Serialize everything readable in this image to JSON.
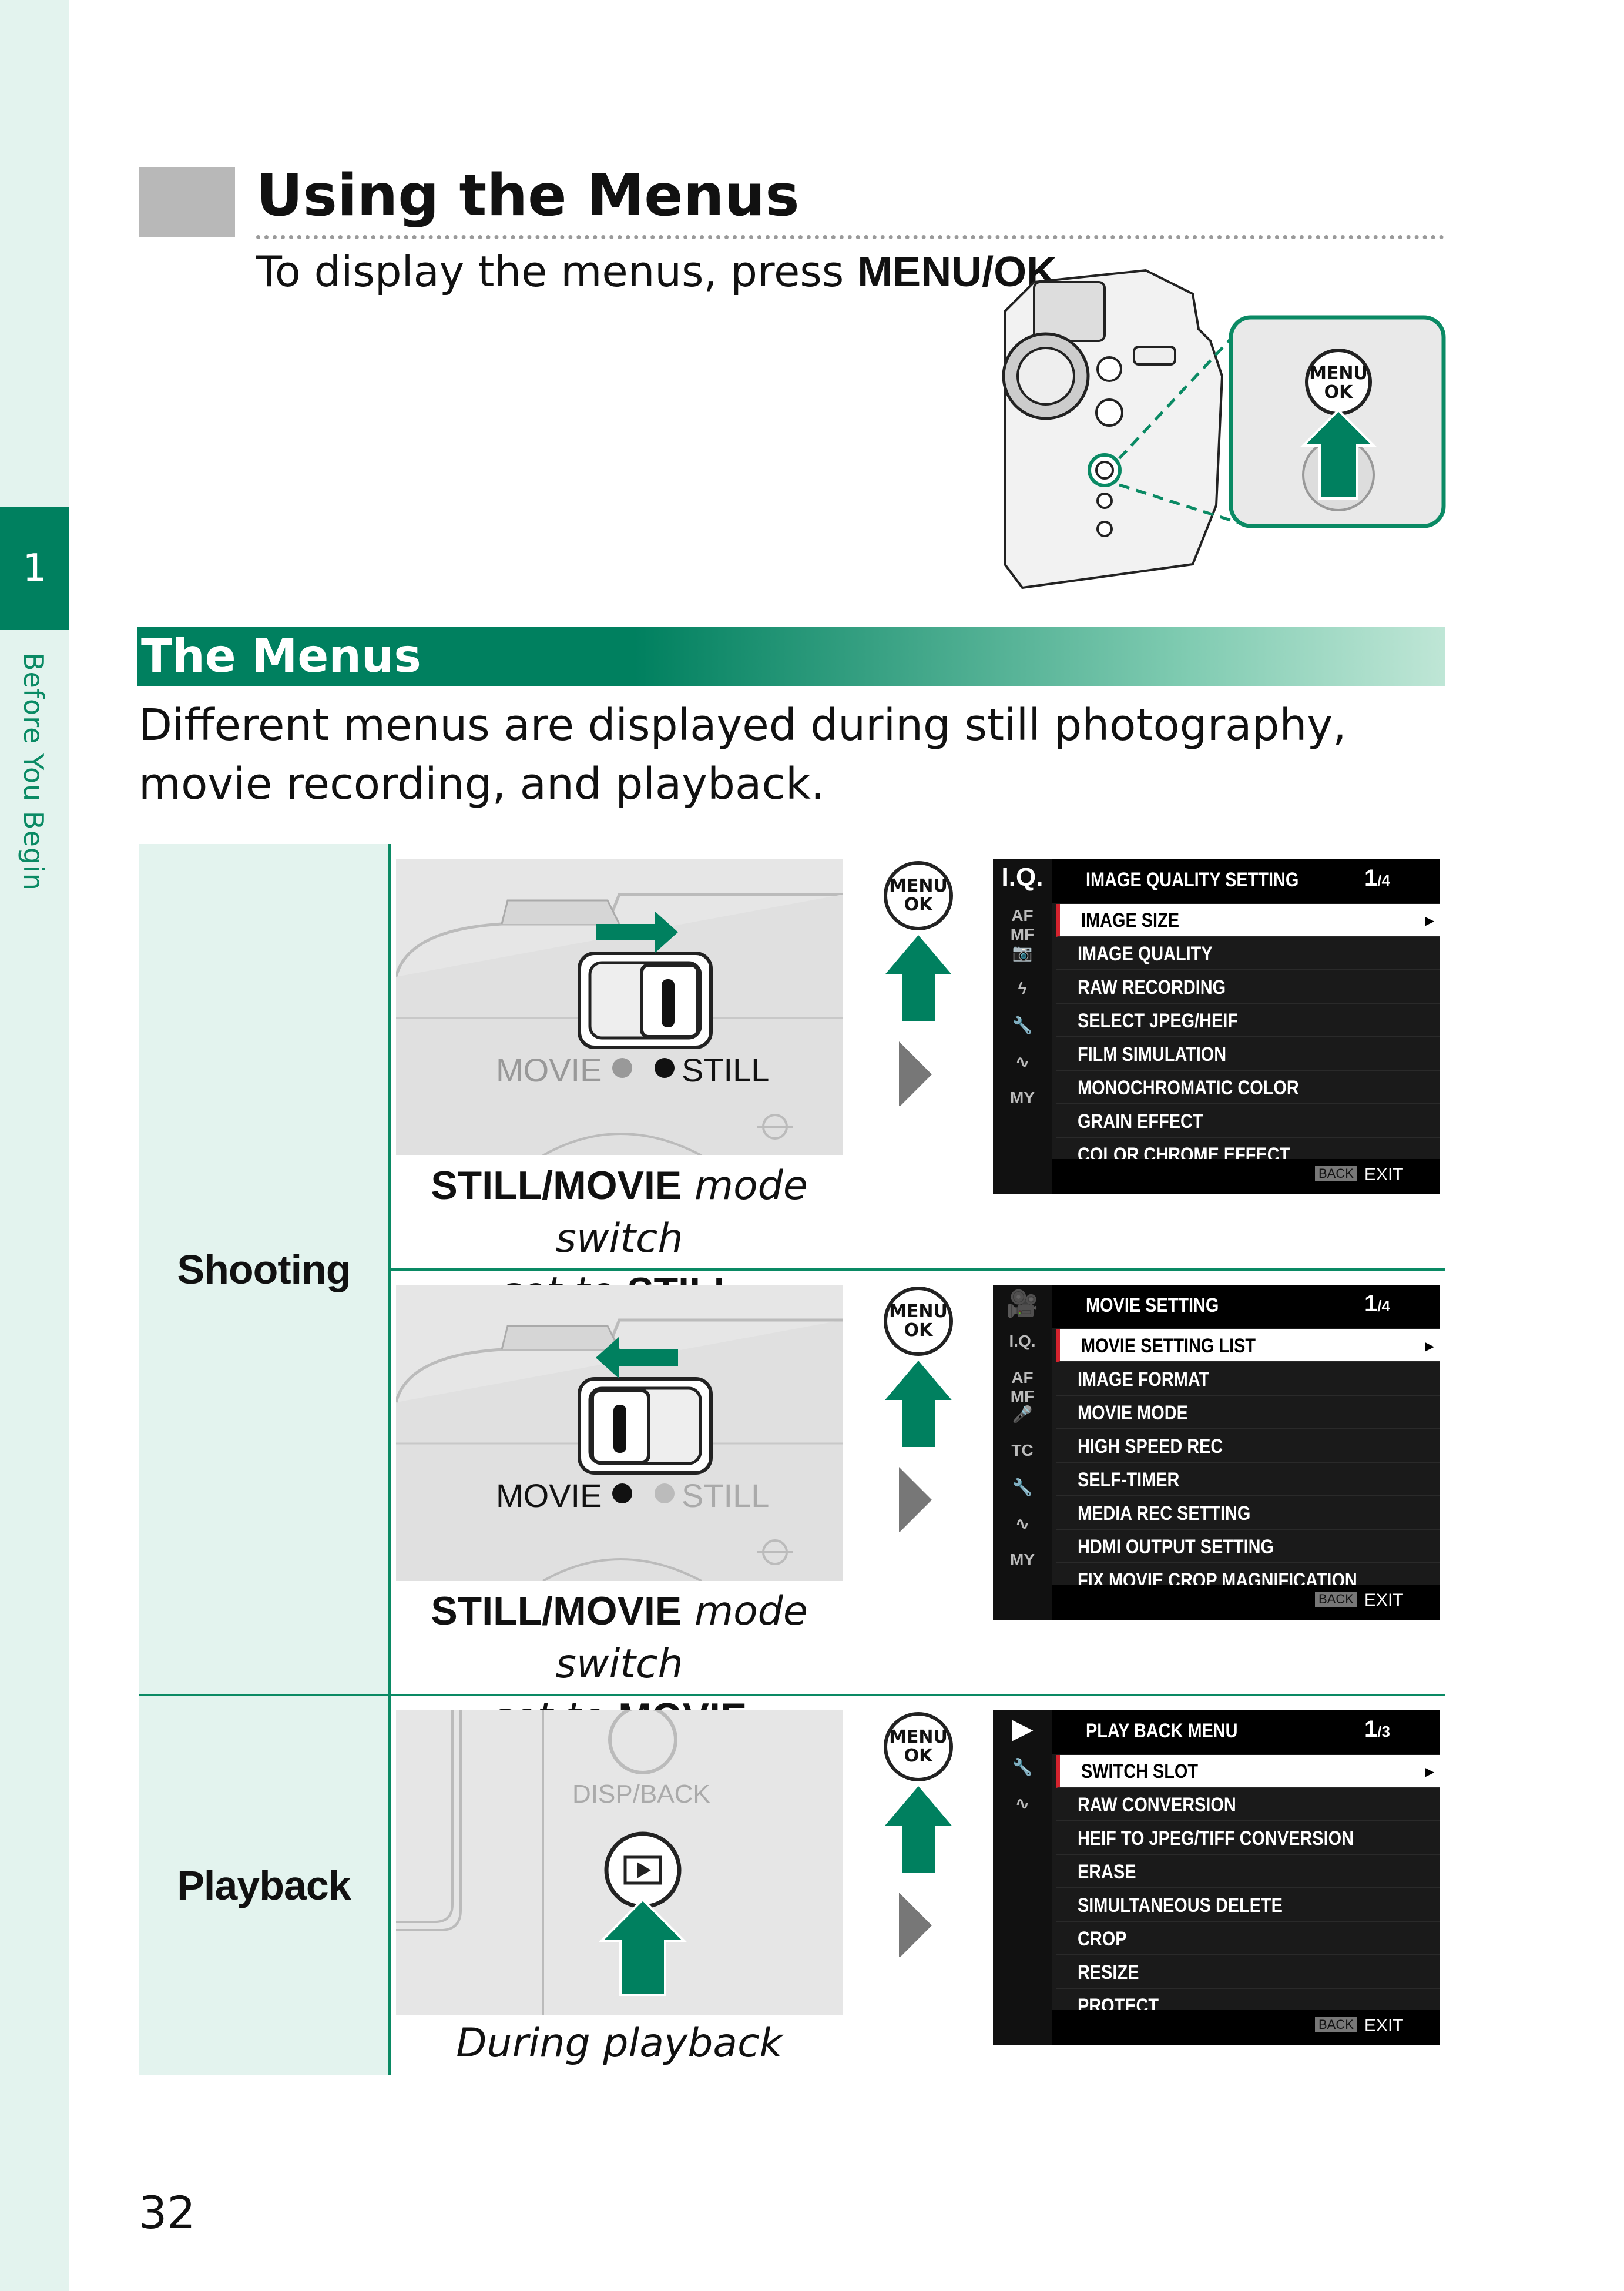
{
  "chapter": {
    "number": "1",
    "label": "Before You Begin"
  },
  "heading": {
    "title": "Using the Menus",
    "intro_text": "To display the menus, press ",
    "intro_button": "MENU/OK",
    "intro_end": "."
  },
  "section": {
    "title": "The Menus",
    "description": "Different menus are displayed during still photography, movie recording, and playback."
  },
  "button_label": {
    "menu": "MENU",
    "ok": "OK"
  },
  "rows": {
    "shooting": {
      "label": "Shooting",
      "switch_labels": {
        "movie": "MOVIE",
        "still": "STILL"
      },
      "still": {
        "caption_bold": "STILL/MOVIE",
        "caption_text": " mode switch",
        "caption_text2": "set to ",
        "caption_value": "STILL",
        "screen": {
          "title": "IMAGE QUALITY SETTING",
          "page": "1",
          "pages": "/4",
          "side_icons": [
            "I.Q.",
            "AF MF",
            "📷",
            "ϟ",
            "🔧",
            "∿",
            "MY"
          ],
          "items": [
            "IMAGE SIZE",
            "IMAGE QUALITY",
            "RAW RECORDING",
            "SELECT JPEG/HEIF",
            "FILM SIMULATION",
            "MONOCHROMATIC COLOR",
            "GRAIN EFFECT",
            "COLOR CHROME EFFECT"
          ],
          "back": "BACK",
          "exit": "EXIT"
        }
      },
      "movie": {
        "caption_bold": "STILL/MOVIE",
        "caption_text": " mode switch",
        "caption_text2": "set to ",
        "caption_value": "MOVIE",
        "screen": {
          "title": "MOVIE SETTING",
          "page": "1",
          "pages": "/4",
          "side_icons": [
            "🎥",
            "I.Q.",
            "AF MF",
            "🎤",
            "TC",
            "🔧",
            "∿",
            "MY"
          ],
          "items": [
            "MOVIE SETTING LIST",
            "IMAGE FORMAT",
            "MOVIE MODE",
            "HIGH SPEED REC",
            "SELF-TIMER",
            "MEDIA REC SETTING",
            "HDMI OUTPUT SETTING",
            "FIX MOVIE CROP MAGNIFICATION"
          ],
          "back": "BACK",
          "exit": "EXIT"
        }
      }
    },
    "playback": {
      "label": "Playback",
      "disp_back": "DISP/BACK",
      "caption": "During playback",
      "screen": {
        "title": "PLAY BACK MENU",
        "page": "1",
        "pages": "/3",
        "side_icons": [
          "▶",
          "🔧",
          "∿"
        ],
        "items": [
          "SWITCH SLOT",
          "RAW CONVERSION",
          "HEIF TO JPEG/TIFF CONVERSION",
          "ERASE",
          "SIMULTANEOUS DELETE",
          "CROP",
          "RESIZE",
          "PROTECT"
        ],
        "back": "BACK",
        "exit": "EXIT"
      }
    }
  },
  "page_number": "32",
  "colors": {
    "accent": "#00805f",
    "tint": "#e3f3ee",
    "highlight": "#d4232e"
  }
}
